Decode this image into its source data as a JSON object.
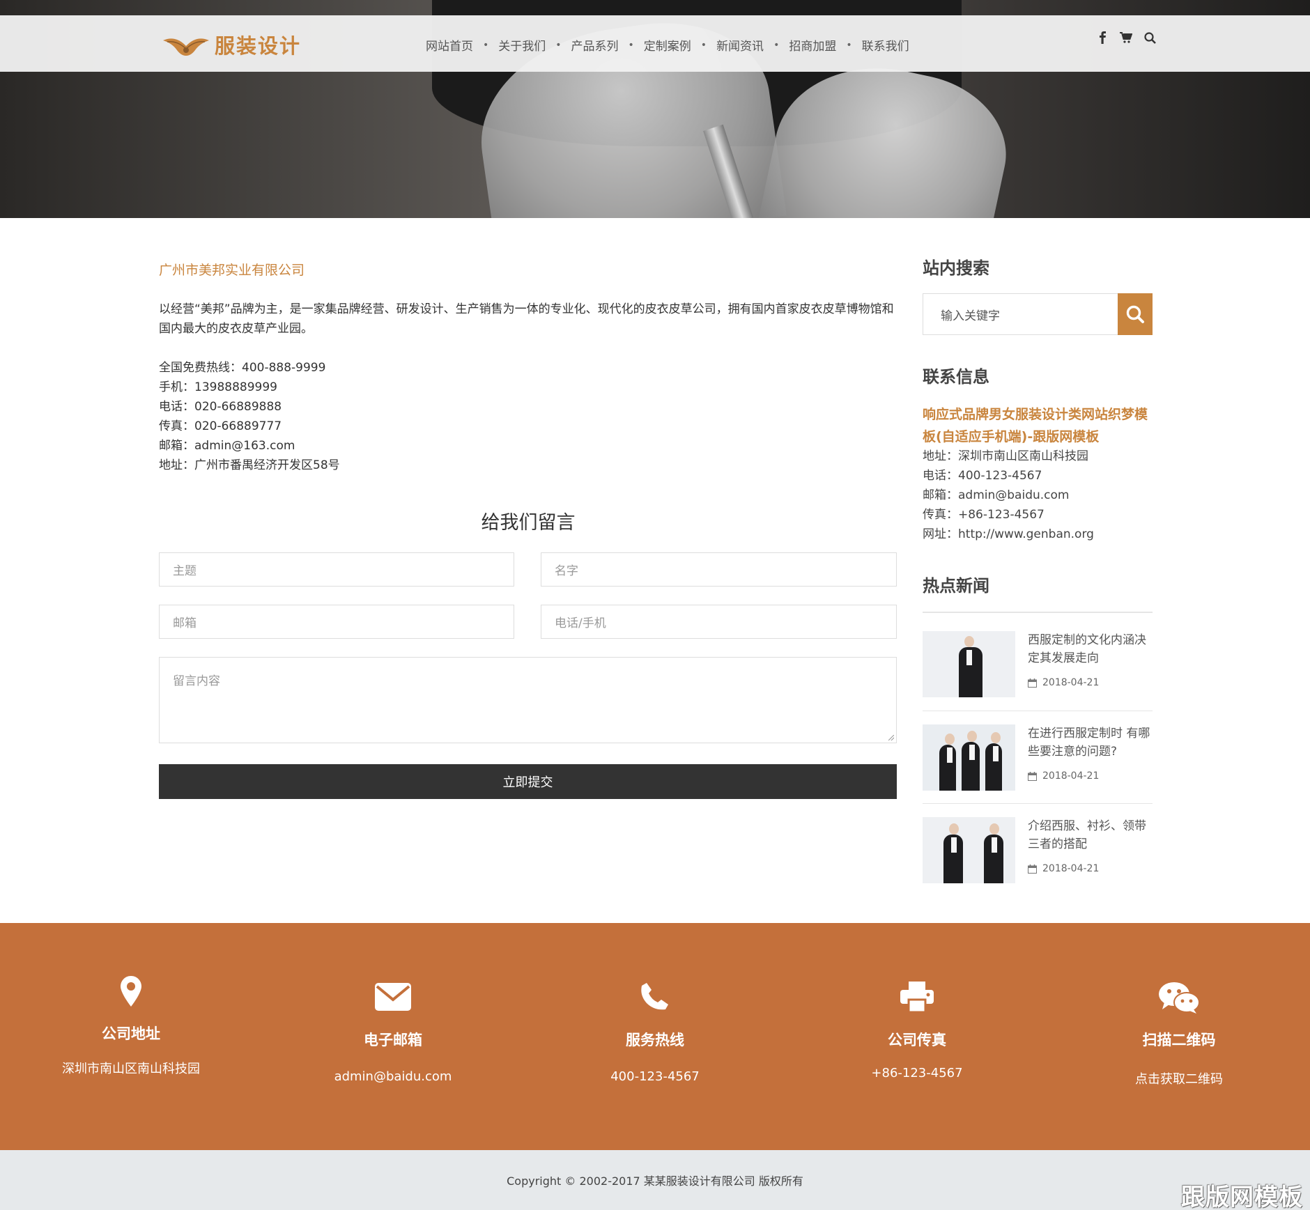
{
  "brand": {
    "name": "服装设计",
    "accent": "#c9853e",
    "footer_bg": "#c4703b"
  },
  "nav": {
    "items": [
      "网站首页",
      "关于我们",
      "产品系列",
      "定制案例",
      "新闻资讯",
      "招商加盟",
      "联系我们"
    ],
    "separator": "•",
    "icons": [
      "facebook-icon",
      "cart-icon",
      "search-icon"
    ]
  },
  "main": {
    "company": "广州市美邦实业有限公司",
    "intro": "以经营“美邦”品牌为主，是一家集品牌经营、研发设计、生产销售为一体的专业化、现代化的皮衣皮草公司，拥有国内首家皮衣皮草博物馆和国内最大的皮衣皮草产业园。",
    "contacts": [
      "全国免费热线：400-888-9999",
      "手机：13988889999",
      "电话：020-66889888",
      "传真：020-66889777",
      "邮箱：admin@163.com",
      "地址：广州市番禺经济开发区58号"
    ],
    "form": {
      "title": "给我们留言",
      "subject_placeholder": "主题",
      "name_placeholder": "名字",
      "email_placeholder": "邮箱",
      "phone_placeholder": "电话/手机",
      "message_placeholder": "留言内容",
      "submit_label": "立即提交"
    }
  },
  "sidebar": {
    "search_heading": "站内搜索",
    "search_placeholder": "输入关键字",
    "contact_heading": "联系信息",
    "contact_title": "响应式品牌男女服装设计类网站织梦模板(自适应手机端)-跟版网模板",
    "contact_lines": [
      "地址：深圳市南山区南山科技园",
      "电话：400-123-4567",
      "邮箱：admin@baidu.com",
      "传真：+86-123-4567",
      "网址：http://www.genban.org"
    ],
    "news_heading": "热点新闻",
    "news": [
      {
        "title": "西服定制的文化内涵决定其发展走向",
        "date": "2018-04-21"
      },
      {
        "title": "在进行西服定制时 有哪些要注意的问题?",
        "date": "2018-04-21"
      },
      {
        "title": "介绍西服、衬衫、领带三者的搭配",
        "date": "2018-04-21"
      }
    ]
  },
  "footer": {
    "columns": [
      {
        "icon": "map-pin-icon",
        "label": "公司地址",
        "value": "深圳市南山区南山科技园"
      },
      {
        "icon": "envelope-icon",
        "label": "电子邮箱",
        "value": "admin@baidu.com"
      },
      {
        "icon": "phone-icon",
        "label": "服务热线",
        "value": "400-123-4567"
      },
      {
        "icon": "printer-icon",
        "label": "公司传真",
        "value": "+86-123-4567"
      },
      {
        "icon": "wechat-icon",
        "label": "扫描二维码",
        "value": "点击获取二维码"
      }
    ],
    "copyright": "Copyright © 2002-2017 某某服装设计有限公司 版权所有",
    "watermark": "跟版网模板"
  }
}
